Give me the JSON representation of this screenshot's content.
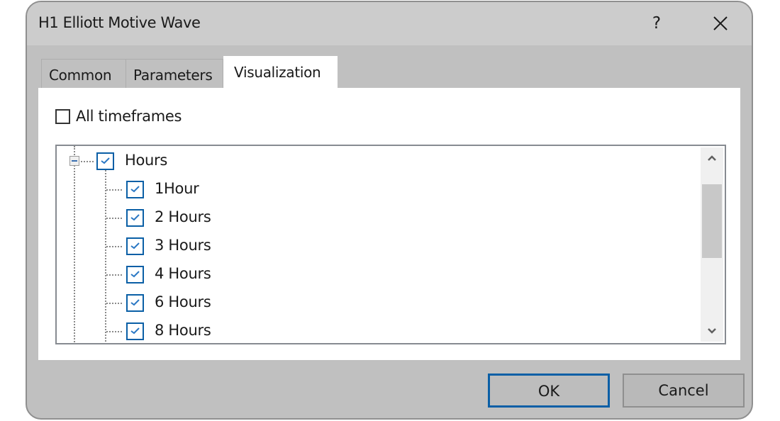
{
  "window": {
    "title": "H1 Elliott Motive Wave",
    "help_label": "?",
    "close_icon": "close-icon"
  },
  "tabs": [
    {
      "label": "Common",
      "active": false
    },
    {
      "label": "Parameters",
      "active": false
    },
    {
      "label": "Visualization",
      "active": true
    }
  ],
  "visualization": {
    "all_timeframes": {
      "label": "All timeframes",
      "checked": false
    },
    "tree": {
      "root": {
        "label": "Hours",
        "checked": true,
        "expanded": true
      },
      "children": [
        {
          "label": "1Hour",
          "checked": true
        },
        {
          "label": "2 Hours",
          "checked": true
        },
        {
          "label": "3 Hours",
          "checked": true
        },
        {
          "label": "4 Hours",
          "checked": true
        },
        {
          "label": "6 Hours",
          "checked": true
        },
        {
          "label": "8 Hours",
          "checked": true
        }
      ]
    }
  },
  "buttons": {
    "ok": "OK",
    "cancel": "Cancel"
  },
  "colors": {
    "accent": "#0a5fa6",
    "dialog_bg": "#c0c0c0",
    "titlebar_bg": "#cccccc"
  }
}
